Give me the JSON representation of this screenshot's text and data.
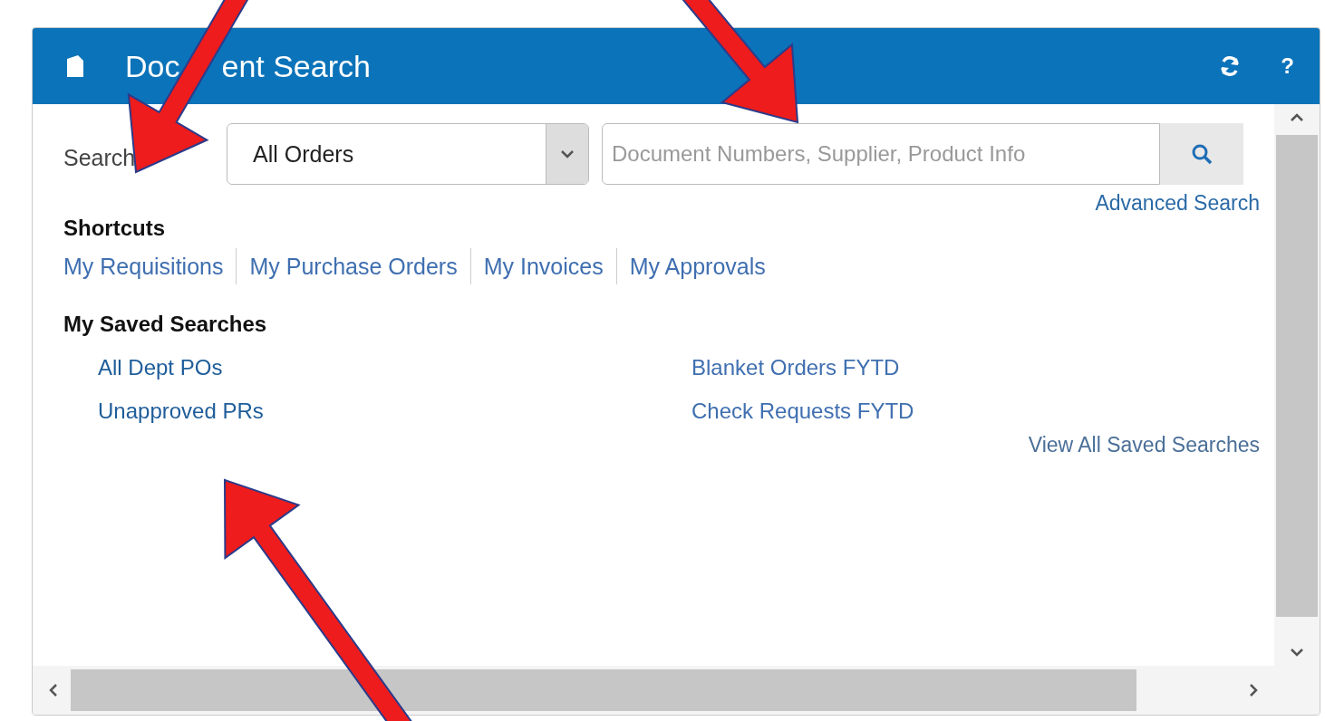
{
  "panel": {
    "title_parts": [
      "Doc",
      "ent Search"
    ],
    "help": "?"
  },
  "search": {
    "label": "Search",
    "scope": "All Orders",
    "placeholder": "Document Numbers, Supplier, Product Info",
    "advanced_link": "Advanced Search"
  },
  "shortcuts": {
    "heading": "Shortcuts",
    "links": [
      "My Requisitions",
      "My Purchase Orders",
      "My Invoices",
      "My Approvals"
    ]
  },
  "saved_searches": {
    "heading": "My Saved Searches",
    "items": [
      "All Dept POs",
      "Unapproved PRs",
      "Blanket Orders FYTD",
      "Check Requests FYTD"
    ],
    "view_all": "View All Saved Searches"
  }
}
